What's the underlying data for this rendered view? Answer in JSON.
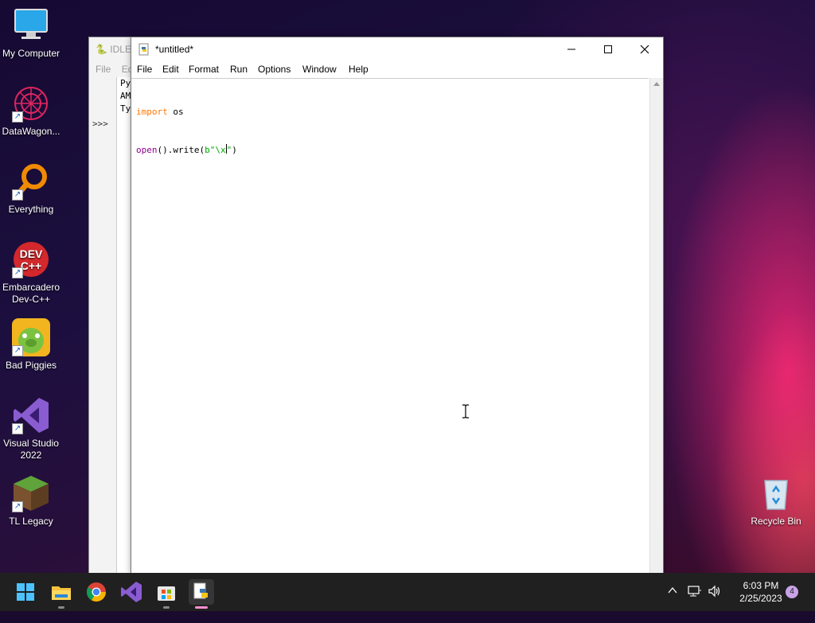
{
  "desktop": {
    "icons": [
      {
        "label": "My Computer"
      },
      {
        "label": "DataWagon..."
      },
      {
        "label": "Everything"
      },
      {
        "label": "Embarcadero Dev-C++"
      },
      {
        "label": "Bad Piggies"
      },
      {
        "label": "Visual Studio 2022"
      },
      {
        "label": "TL Legacy"
      },
      {
        "label": "Recycle Bin"
      }
    ]
  },
  "shell_window": {
    "title": "IDLE",
    "menu_partial": [
      "File",
      "Ed"
    ],
    "lines": [
      "Py",
      "AM",
      "Ty"
    ],
    "prompt": ">>>"
  },
  "editor_window": {
    "title": "*untitled*",
    "menu": [
      "File",
      "Edit",
      "Format",
      "Run",
      "Options",
      "Window",
      "Help"
    ],
    "code": {
      "line1_keyword": "import",
      "line1_rest": " os",
      "line2_builtin": "open",
      "line2_mid": "().write(",
      "line2_string": "b\"\\x",
      "line2_close_quote": "\"",
      "line2_end": ")"
    }
  },
  "taskbar": {
    "apps": [
      "start-icon",
      "file-explorer-icon",
      "chrome-icon",
      "visual-studio-icon",
      "microsoft-store-icon",
      "python-idle-icon"
    ],
    "time": "6:03 PM",
    "date": "2/25/2023",
    "notification_count": "4"
  }
}
